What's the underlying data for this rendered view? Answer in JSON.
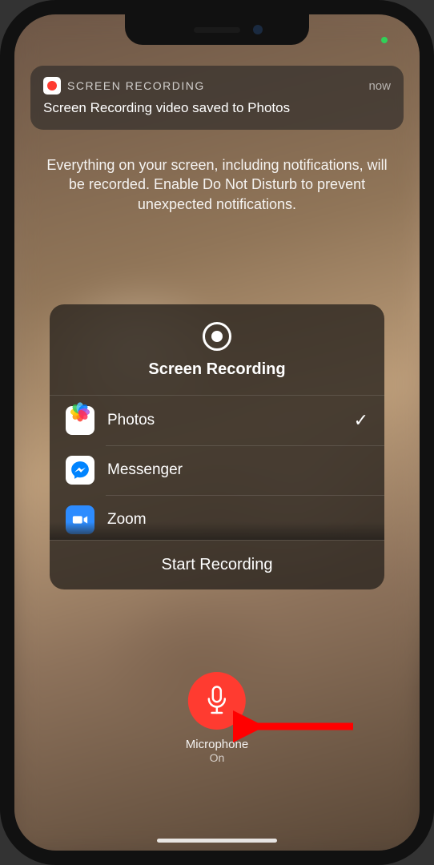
{
  "notification": {
    "app_name": "SCREEN RECORDING",
    "time_label": "now",
    "body": "Screen Recording video saved to Photos"
  },
  "description": "Everything on your screen, including notifications, will be recorded. Enable Do Not Disturb to prevent unexpected notifications.",
  "panel": {
    "title": "Screen Recording",
    "apps": [
      {
        "name": "Photos",
        "selected": true
      },
      {
        "name": "Messenger",
        "selected": false
      },
      {
        "name": "Zoom",
        "selected": false
      }
    ],
    "start_label": "Start Recording"
  },
  "microphone": {
    "label": "Microphone",
    "state": "On"
  },
  "colors": {
    "accent_red": "#ff3b30",
    "messenger_blue": "#0084ff",
    "zoom_blue": "#2d8cff"
  }
}
